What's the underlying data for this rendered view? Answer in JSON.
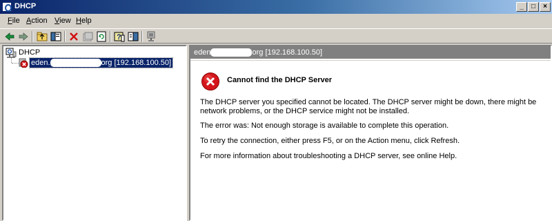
{
  "window": {
    "title": "DHCP",
    "buttons": {
      "minimize": "_",
      "maximize": "□",
      "close": "×"
    }
  },
  "menu": {
    "items": [
      "File",
      "Action",
      "View",
      "Help"
    ]
  },
  "toolbar": {
    "buttons": [
      "back-icon",
      "forward-icon",
      "up-folder-icon",
      "show-hide-tree-icon",
      "delete-icon",
      "properties-icon",
      "refresh-icon",
      "help-icon",
      "action-pane-icon",
      "server-console-icon"
    ]
  },
  "tree": {
    "root_label": "DHCP",
    "server_prefix": "eden.",
    "server_suffix": "org [192.168.100.50]"
  },
  "detail": {
    "header_prefix": "eden",
    "header_suffix": "org [192.168.100.50]",
    "error_title": "Cannot find the DHCP Server",
    "paragraph1": "The DHCP server you specified cannot be located. The DHCP server might be down, there might be network problems, or the DHCP service might not be installed.",
    "paragraph2": "The error was:  Not enough storage is available to complete this operation.",
    "paragraph3": "To retry the connection, either press F5, or on the Action menu, click Refresh.",
    "paragraph4": "For more information about troubleshooting a DHCP server, see online Help."
  },
  "colors": {
    "titlebar": "#0a246a",
    "selection": "#0a246a",
    "error_red": "#d4161c",
    "detail_header": "#808080"
  }
}
